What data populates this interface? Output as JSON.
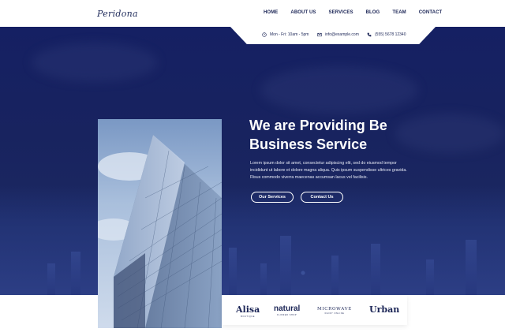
{
  "header": {
    "logo": "Peridona",
    "nav": [
      "HOME",
      "ABOUT US",
      "SERVICES",
      "BLOG",
      "TEAM",
      "CONTACT"
    ]
  },
  "contact_bar": {
    "hours": "Mon - Fri: 10am - 5pm",
    "email": "info@example.com",
    "phone": "(555) 5678 12340"
  },
  "hero": {
    "headline_line1": "We are Providing Be",
    "headline_line2": "Business Service",
    "description": "Lorem ipsum dolor sit amet, consectetur adipiscing elit, sed do eiusmod tempor incididunt ut labore et dolore magna aliqua. Quis ipsum suspendisse ultrices gravida. Risus commodo viverra maecenas accumsan lacus vel facilisis.",
    "button_services": "Our Services",
    "button_contact": "Contact Us"
  },
  "brands": [
    {
      "name": "Alisa",
      "sub": "BOUTIQUE"
    },
    {
      "name": "natural",
      "sub": "FLOWER SHOP"
    },
    {
      "name": "MICROWAVE",
      "sub": "DAIRY ONLINE"
    },
    {
      "name": "Urban",
      "sub": ""
    }
  ],
  "colors": {
    "primary": "#1b2556",
    "hero_bg": "#18235f",
    "white": "#ffffff"
  },
  "icons": [
    "clock-icon",
    "mail-icon",
    "phone-icon"
  ]
}
